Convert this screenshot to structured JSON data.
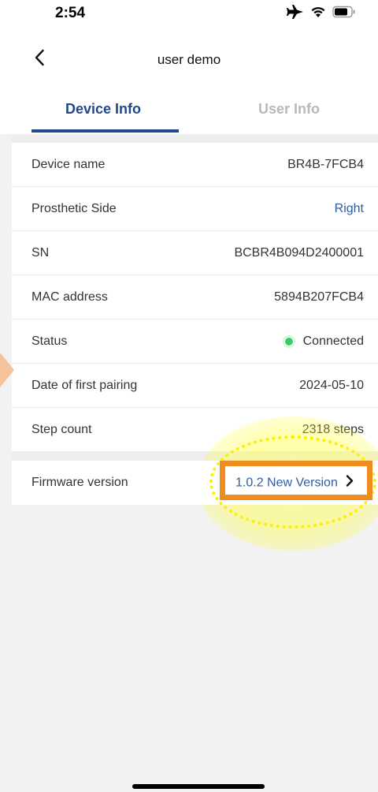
{
  "status_bar": {
    "time": "2:54",
    "icons": [
      "airplane-icon",
      "wifi-icon",
      "battery-icon"
    ]
  },
  "nav": {
    "title": "user demo",
    "back_icon": "chevron-left-icon"
  },
  "tabs": [
    {
      "label": "Device Info",
      "active": true
    },
    {
      "label": "User Info",
      "active": false
    }
  ],
  "device_rows": [
    {
      "label": "Device name",
      "value": "BR4B-7FCB4"
    },
    {
      "label": "Prosthetic Side",
      "value": "Right"
    },
    {
      "label": "SN",
      "value": "BCBR4B094D2400001"
    },
    {
      "label": "MAC address",
      "value": "5894B207FCB4"
    },
    {
      "label": "Status",
      "value": "Connected",
      "status_color": "#33cc66"
    },
    {
      "label": "Date of first pairing",
      "value": "2024-05-10"
    },
    {
      "label": "Step count",
      "value": "2318 steps"
    }
  ],
  "firmware": {
    "label": "Firmware version",
    "value": "1.0.2 New Version",
    "chevron_icon": "chevron-right-icon"
  },
  "colors": {
    "accent": "#24478a",
    "link": "#2f5ba6",
    "inactive_tab": "#b9b9b9",
    "highlight_box": "#ef8c1f",
    "highlight_glow": "#ffff00"
  }
}
